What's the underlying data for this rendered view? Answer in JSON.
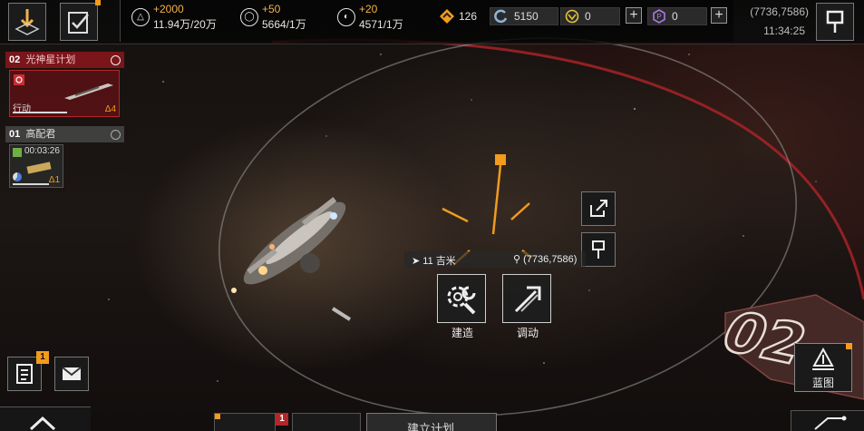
{
  "resources": [
    {
      "icon": "triangle-icon",
      "plus": "+2000",
      "value": "11.94万/20万"
    },
    {
      "icon": "ring-icon",
      "plus": "+50",
      "value": "5664/1万"
    },
    {
      "icon": "crystal-icon",
      "plus": "+20",
      "value": "4571/1万"
    }
  ],
  "currencies": {
    "rank": "126",
    "credits": "5150",
    "gold": "0",
    "premium": "0"
  },
  "location": {
    "coords": "(7736,7586)",
    "time": "11:34:25"
  },
  "fleets": [
    {
      "number": "02",
      "name": "光神星计划",
      "status": "行动",
      "level": "4"
    },
    {
      "number": "01",
      "name": "高配君",
      "timer": "00:03:26",
      "level": "1"
    }
  ],
  "target": {
    "distance": "11 吉米",
    "coords": "(7736,7586)"
  },
  "actions": {
    "build": "建造",
    "dispatch": "调动"
  },
  "zone_label": "02",
  "blueprint_label": "蓝图",
  "bottom": {
    "plan_label": "建立计划"
  },
  "badges": {
    "mail_count": "1",
    "bottom_count": "1"
  },
  "colors": {
    "accent": "#f29b1d",
    "danger": "#b3262a",
    "panel": "#1b1b1b"
  }
}
